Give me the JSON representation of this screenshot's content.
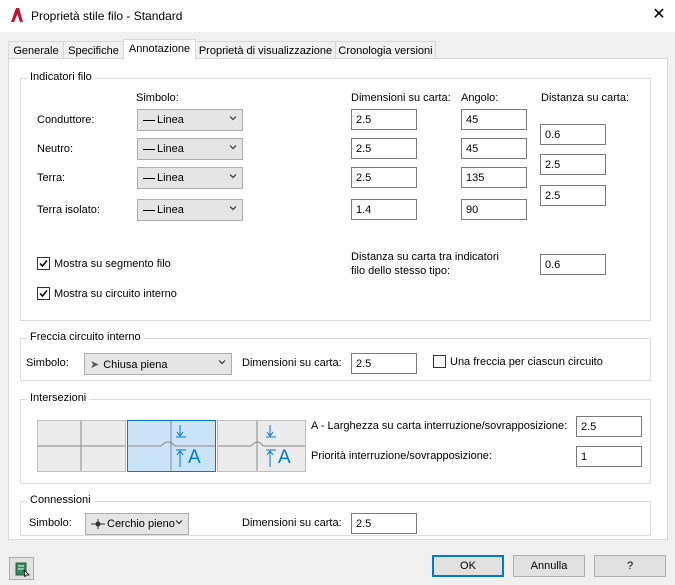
{
  "window": {
    "title": "Proprietà stile filo - Standard",
    "app_logo": "autocad-a-logo",
    "close_glyph": "✕"
  },
  "tabs": [
    {
      "label": "Generale",
      "active": false
    },
    {
      "label": "Specifiche",
      "active": false
    },
    {
      "label": "Annotazione",
      "active": true
    },
    {
      "label": "Proprietà di visualizzazione",
      "active": false
    },
    {
      "label": "Cronologia versioni",
      "active": false
    }
  ],
  "indicatori": {
    "title": "Indicatori filo",
    "col_simbolo": "Simbolo:",
    "col_dimensioni": "Dimensioni su carta:",
    "col_angolo": "Angolo:",
    "col_distanza": "Distanza su carta:",
    "rows": [
      {
        "label": "Conduttore:",
        "symbol": "Linea",
        "size": "2.5",
        "angle": "45"
      },
      {
        "label": "Neutro:",
        "symbol": "Linea",
        "size": "2.5",
        "angle": "45"
      },
      {
        "label": "Terra:",
        "symbol": "Linea",
        "size": "2.5",
        "angle": "135"
      },
      {
        "label": "Terra isolato:",
        "symbol": "Linea",
        "size": "1.4",
        "angle": "90"
      }
    ],
    "distances": [
      "0.6",
      "2.5",
      "2.5"
    ],
    "mostra_segmento": "Mostra su segmento filo",
    "mostra_segmento_checked": true,
    "mostra_circuito": "Mostra su circuito interno",
    "mostra_circuito_checked": true,
    "distanza_tra_label": "Distanza su carta tra indicatori filo dello stesso tipo:",
    "distanza_tra_line1": "Distanza su carta tra indicatori",
    "distanza_tra_line2": "filo dello stesso tipo:",
    "distanza_tra_value": "0.6"
  },
  "freccia": {
    "title": "Freccia circuito interno",
    "simbolo_label": "Simbolo:",
    "simbolo_value": "Chiusa piena",
    "dimensioni_label": "Dimensioni su carta:",
    "dimensioni_value": "2.5",
    "una_freccia_label": "Una freccia per ciascun circuito",
    "una_freccia_checked": false
  },
  "intersezioni": {
    "title": "Intersezioni",
    "larghezza_label": "A - Larghezza su carta interruzione/sovrapposizione:",
    "larghezza_value": "2.5",
    "priorita_label": "Priorità interruzione/sovrapposizione:",
    "priorita_value": "1",
    "selected_option": 2,
    "glyph_a": "A"
  },
  "connessioni": {
    "title": "Connessioni",
    "simbolo_label": "Simbolo:",
    "simbolo_value": "Cerchio pieno",
    "dimensioni_label": "Dimensioni su carta:",
    "dimensioni_value": "2.5"
  },
  "footer": {
    "ok": "OK",
    "annulla": "Annulla",
    "help": "?"
  },
  "colors": {
    "accent": "#0078d7",
    "selected_bg": "#cce4f7",
    "logo_red": "#c8102e"
  }
}
